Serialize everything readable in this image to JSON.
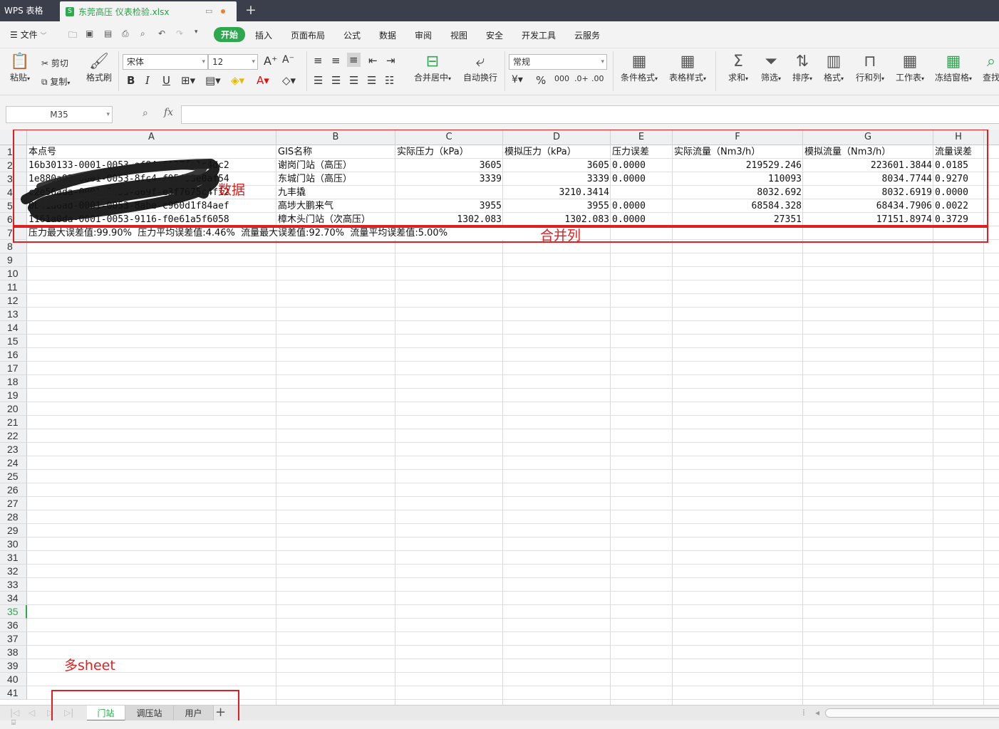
{
  "titlebar": {
    "app_tab": "WPS 表格",
    "file_tab": "东莞高压 仪表检验.xlsx",
    "new_tab_icon": "plus-icon"
  },
  "menubar": {
    "file_label": "文件",
    "items": [
      "开始",
      "插入",
      "页面布局",
      "公式",
      "数据",
      "审阅",
      "视图",
      "安全",
      "开发工具",
      "云服务"
    ],
    "active": "开始",
    "accent_color": "#2ea84e"
  },
  "ribbon": {
    "paste": "粘贴",
    "cut": "剪切",
    "copy": "复制",
    "format_painter": "格式刷",
    "font_name": "宋体",
    "font_size": "12",
    "merge_center": "合并居中",
    "wrap_text": "自动换行",
    "number_format": "常规",
    "conditional_format": "条件格式",
    "table_style": "表格样式",
    "sum": "求和",
    "filter": "筛选",
    "sort": "排序",
    "format": "格式",
    "rows_cols": "行和列",
    "worksheet": "工作表",
    "freeze": "冻结窗格",
    "find": "查找"
  },
  "formula_bar": {
    "name_box": "M35",
    "fx_label": "fx",
    "formula": ""
  },
  "sheet": {
    "columns": [
      "A",
      "B",
      "C",
      "D",
      "E",
      "F",
      "G",
      "H"
    ],
    "row_numbers": [
      "1",
      "2",
      "3",
      "4",
      "5",
      "6",
      "7",
      "8",
      "9",
      "10",
      "11",
      "12",
      "13",
      "14",
      "15",
      "16",
      "17",
      "18",
      "19",
      "20",
      "21",
      "22",
      "23",
      "24",
      "25",
      "26",
      "27",
      "28",
      "29",
      "30",
      "31",
      "32",
      "33",
      "34",
      "35",
      "36",
      "37",
      "38",
      "39",
      "40",
      "41"
    ],
    "active_row": "35",
    "header_row": [
      "本点号",
      "GIS名称",
      "实际压力（kPa）",
      "模拟压力（kPa）",
      "压力误差",
      "实际流量（Nm3/h）",
      "模拟流量（Nm3/h）",
      "流量误差"
    ],
    "rows": [
      [
        "16b30133-0001-0053-af84-f127fe1c4dc2",
        "谢岗门站（高压）",
        "3605",
        "3605",
        "0.0000",
        "219529.246",
        "223601.3844",
        "0.0185"
      ],
      [
        "1e880a93-0001-0053-8fc4-f05f03e0af54",
        "东城门站（高压）",
        "3339",
        "3339",
        "0.0000",
        "110093",
        "8034.7744",
        "0.9270"
      ],
      [
        "c2e56ada-0001-0053-869f-e3f7675c4f12",
        "九丰撬",
        "",
        "3210.3414",
        "",
        "8032.692",
        "8032.6919",
        "0.0000"
      ],
      [
        "0b41a6ad-0001-0053-8abe-c960d1f84aef",
        "高埗大鹏来气",
        "3955",
        "3955",
        "0.0000",
        "68584.328",
        "68434.7906",
        "0.0022"
      ],
      [
        "1161a0da-0001-0053-9116-f0e61a5f6058",
        "樟木头门站（次高压）",
        "1302.083",
        "1302.083",
        "0.0000",
        "27351",
        "17151.8974",
        "0.3729"
      ]
    ],
    "summary_row": "压力最大误差值:99.90%  压力平均误差值:4.46%  流量最大误差值:92.70%  流量平均误差值:5.00%"
  },
  "annotations": {
    "data_label": "数据",
    "merge_label": "合并列",
    "multisheet_label": "多sheet",
    "color": "#e02020"
  },
  "sheet_tabs": {
    "tabs": [
      "门站",
      "调压站",
      "用户"
    ],
    "active": "门站"
  }
}
